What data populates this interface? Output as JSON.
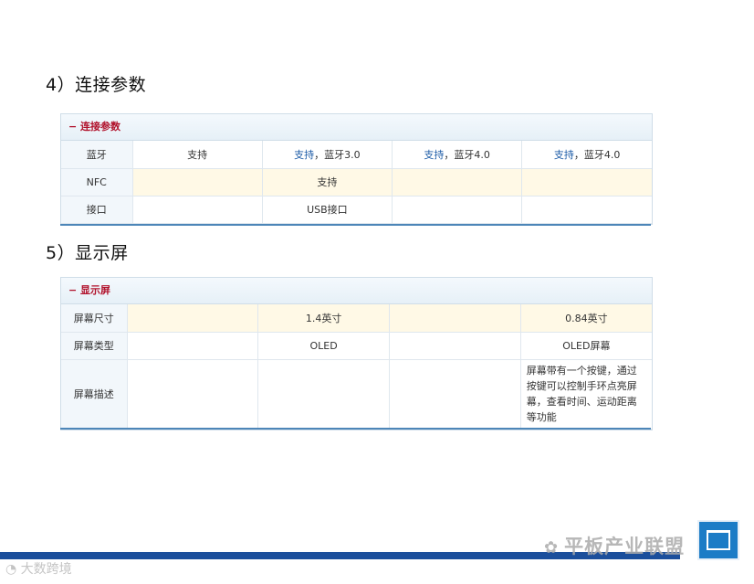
{
  "section4": {
    "heading": "4）连接参数",
    "panel_title": "连接参数",
    "rows": [
      {
        "label": "蓝牙",
        "cells": [
          "支持",
          "支持，蓝牙3.0",
          "支持，蓝牙4.0",
          "支持，蓝牙4.0"
        ]
      },
      {
        "label": "NFC",
        "cells": [
          "",
          "支持",
          "",
          ""
        ]
      },
      {
        "label": "接口",
        "cells": [
          "",
          "USB接口",
          "",
          ""
        ]
      }
    ]
  },
  "section5": {
    "heading": "5）显示屏",
    "panel_title": "显示屏",
    "rows": [
      {
        "label": "屏幕尺寸",
        "cells": [
          "",
          "1.4英寸",
          "",
          "0.84英寸"
        ]
      },
      {
        "label": "屏幕类型",
        "cells": [
          "",
          "OLED",
          "",
          "OLED屏幕"
        ]
      },
      {
        "label": "屏幕描述",
        "cells": [
          "",
          "",
          "",
          "屏幕带有一个按键，通过按键可以控制手环点亮屏幕，查看时间、运动距离等功能"
        ]
      }
    ]
  },
  "watermarks": {
    "right": "平板产业联盟",
    "left": "大数跨境"
  },
  "colors": {
    "panel_title": "#b0102a",
    "highlight_cell": "#fff9e6",
    "label_cell": "#f2f7fb",
    "footer_bar": "#1b4f9c",
    "logo": "#1c7cc6"
  }
}
